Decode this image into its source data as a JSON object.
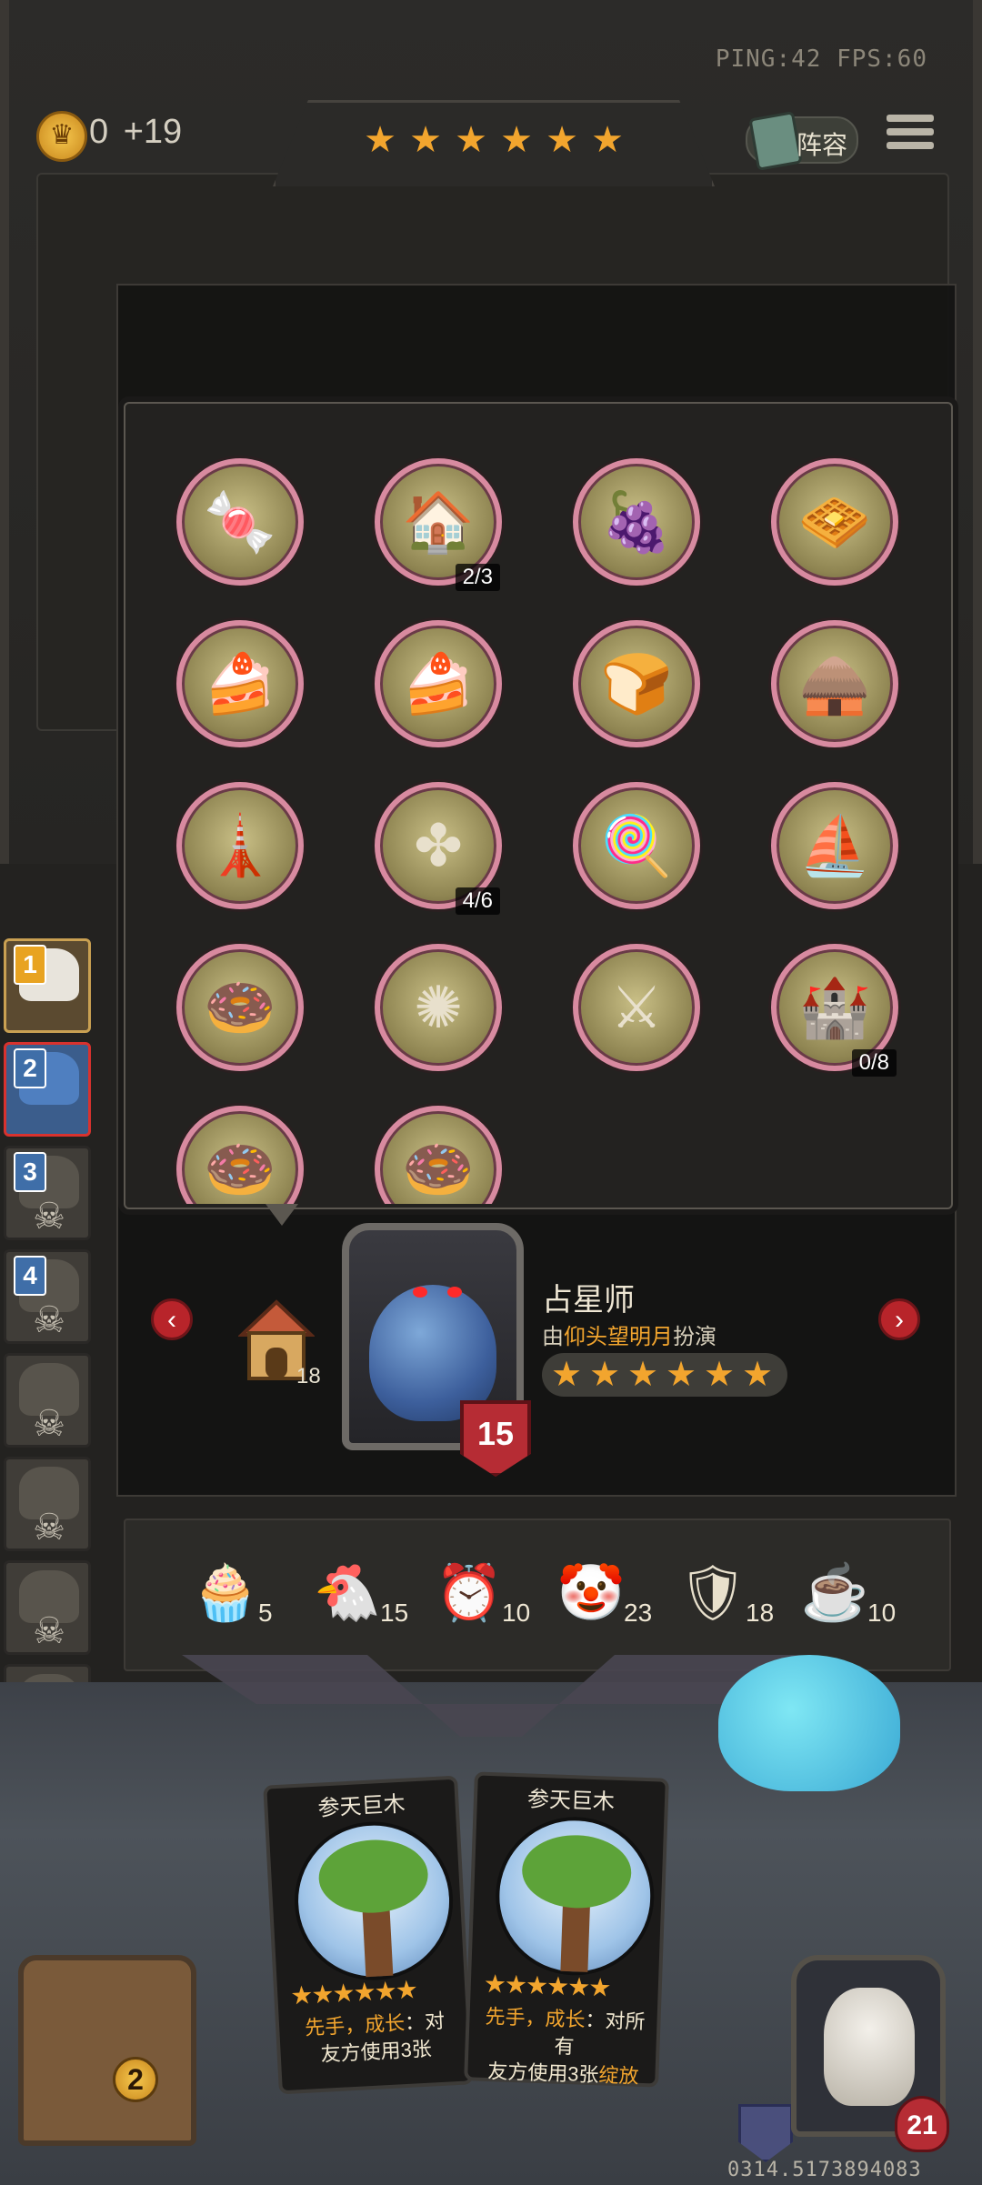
{
  "top_bar": {
    "gold": "0",
    "gold_income": "+19",
    "gold_icon": "crown-coin-icon",
    "star_count": 6,
    "ping_fps": "PING:42   FPS:60",
    "lineup_label": "阵容",
    "menu_icon": "hamburger-menu-icon"
  },
  "popup": {
    "items": [
      {
        "icon": "candy-garden-icon",
        "count": ""
      },
      {
        "icon": "toy-bakery-icon",
        "count": "2/3"
      },
      {
        "icon": "grape-clinic-icon",
        "count": ""
      },
      {
        "icon": "wafer-stack-icon",
        "count": ""
      },
      {
        "icon": "dessert-table-icon",
        "count": ""
      },
      {
        "icon": "dessert-table-icon",
        "count": ""
      },
      {
        "icon": "bread-oven-icon",
        "count": ""
      },
      {
        "icon": "treasure-barn-icon",
        "count": ""
      },
      {
        "icon": "lighthouse-icon",
        "count": ""
      },
      {
        "icon": "wafer-pinwheel-icon",
        "count": "4/6"
      },
      {
        "icon": "candy-shop-icon",
        "count": ""
      },
      {
        "icon": "sail-ship-icon",
        "count": ""
      },
      {
        "icon": "donut-cannon-icon",
        "count": ""
      },
      {
        "icon": "jelly-splash-icon",
        "count": ""
      },
      {
        "icon": "golden-knight-icon",
        "count": ""
      },
      {
        "icon": "donut-castle-icon",
        "count": "0/8"
      },
      {
        "icon": "donut-cannon-icon",
        "count": ""
      },
      {
        "icon": "donut-cannon-icon",
        "count": ""
      }
    ]
  },
  "hero": {
    "name": "占星师",
    "by_prefix": "由",
    "by_player": "仰头望明月",
    "by_suffix": "扮演",
    "level": "15",
    "stars": 6,
    "house_count": "18",
    "prev_icon": "chevron-left-icon",
    "next_icon": "chevron-right-icon"
  },
  "resources": [
    {
      "icon": "cupcake-icon",
      "value": "5"
    },
    {
      "icon": "rubber-chicken-icon",
      "value": "15"
    },
    {
      "icon": "alarm-clock-icon",
      "value": "10"
    },
    {
      "icon": "clown-icon",
      "value": "23"
    },
    {
      "icon": "striped-shield-icon",
      "value": "18"
    },
    {
      "icon": "teacup-icon",
      "value": "10"
    }
  ],
  "sidebar": [
    {
      "num": "1",
      "state": "self"
    },
    {
      "num": "2",
      "state": "selected"
    },
    {
      "num": "3",
      "state": "dead"
    },
    {
      "num": "4",
      "state": "dead"
    },
    {
      "num": "",
      "state": "dead"
    },
    {
      "num": "",
      "state": "dead"
    },
    {
      "num": "",
      "state": "dead"
    },
    {
      "num": "",
      "state": "dead"
    }
  ],
  "cards": [
    {
      "title": "参天巨木",
      "stars": 6,
      "desc_key": "先手，成长",
      "desc_rest_line1": "：对",
      "desc_line2": "友方使用3张"
    },
    {
      "title": "参天巨木",
      "stars": 6,
      "desc_key": "先手，成长",
      "desc_rest_line1": "：对所有",
      "desc_line2": "友方使用3张",
      "desc_key2": "绽放"
    }
  ],
  "player": {
    "shop_level": "2",
    "hp": "21"
  },
  "seed": "0314.5173894083",
  "colors": {
    "accent_gold": "#f2a52e",
    "frame_pink": "#d88aa0",
    "badge_red": "#b62c34",
    "panel_dark": "#232220"
  }
}
